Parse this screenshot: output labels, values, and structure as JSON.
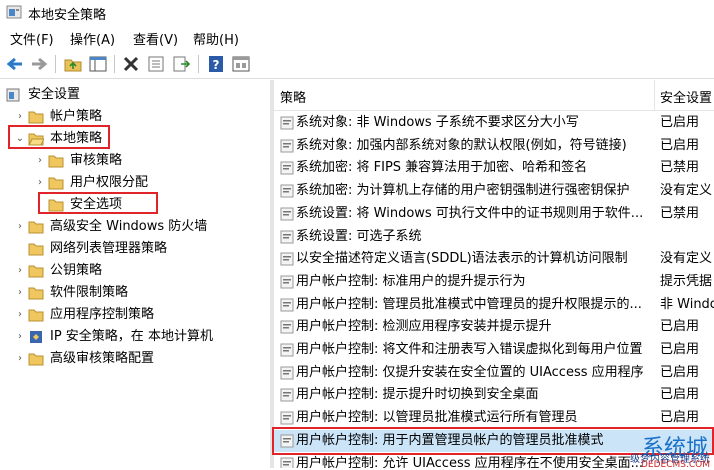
{
  "window": {
    "title": "本地安全策略"
  },
  "menu": [
    "文件(F)",
    "操作(A)",
    "查看(V)",
    "帮助(H)"
  ],
  "toolbar": [
    {
      "icon": "back-arrow-icon"
    },
    {
      "icon": "forward-arrow-icon"
    },
    {
      "icon": "up-folder-icon"
    },
    {
      "icon": "show-hide-tree-icon"
    },
    {
      "icon": "delete-icon"
    },
    {
      "icon": "properties-icon"
    },
    {
      "icon": "export-list-icon"
    },
    {
      "icon": "help-icon"
    },
    {
      "icon": "view-icon"
    }
  ],
  "tree": [
    {
      "label": "安全设置",
      "level": 0,
      "expander": "",
      "icon": "security-settings-icon"
    },
    {
      "label": "帐户策略",
      "level": 1,
      "expander": "›",
      "icon": "folder-icon"
    },
    {
      "label": "本地策略",
      "level": 1,
      "expander": "⌄",
      "icon": "folder-open-icon"
    },
    {
      "label": "审核策略",
      "level": 2,
      "expander": "›",
      "icon": "folder-icon"
    },
    {
      "label": "用户权限分配",
      "level": 2,
      "expander": "›",
      "icon": "folder-icon"
    },
    {
      "label": "安全选项",
      "level": 2,
      "expander": "",
      "icon": "folder-icon"
    },
    {
      "label": "高级安全 Windows 防火墙",
      "level": 1,
      "expander": "›",
      "icon": "folder-icon"
    },
    {
      "label": "网络列表管理器策略",
      "level": 1,
      "expander": "",
      "icon": "folder-icon"
    },
    {
      "label": "公钥策略",
      "level": 1,
      "expander": "›",
      "icon": "folder-icon"
    },
    {
      "label": "软件限制策略",
      "level": 1,
      "expander": "›",
      "icon": "folder-icon"
    },
    {
      "label": "应用程序控制策略",
      "level": 1,
      "expander": "›",
      "icon": "folder-icon"
    },
    {
      "label": "IP 安全策略，在 本地计算机",
      "level": 1,
      "expander": "›",
      "icon": "ip-security-icon"
    },
    {
      "label": "高级审核策略配置",
      "level": 1,
      "expander": "›",
      "icon": "folder-icon"
    }
  ],
  "list": {
    "columns": [
      "策略",
      "安全设置"
    ],
    "rows": [
      {
        "policy": "系统对象: 非 Windows 子系统不要求区分大小写",
        "setting": "已启用"
      },
      {
        "policy": "系统对象: 加强内部系统对象的默认权限(例如，符号链接)",
        "setting": "已启用"
      },
      {
        "policy": "系统加密: 将 FIPS 兼容算法用于加密、哈希和签名",
        "setting": "已禁用"
      },
      {
        "policy": "系统加密: 为计算机上存储的用户密钥强制进行强密钥保护",
        "setting": "没有定义"
      },
      {
        "policy": "系统设置: 将 Windows 可执行文件中的证书规则用于软件...",
        "setting": "已禁用"
      },
      {
        "policy": "系统设置: 可选子系统",
        "setting": ""
      },
      {
        "policy": "以安全描述符定义语言(SDDL)语法表示的计算机访问限制",
        "setting": "没有定义"
      },
      {
        "policy": "用户帐户控制: 标准用户的提升提示行为",
        "setting": "提示凭据"
      },
      {
        "policy": "用户帐户控制: 管理员批准模式中管理员的提升权限提示的...",
        "setting": "非 Windo"
      },
      {
        "policy": "用户帐户控制: 检测应用程序安装并提示提升",
        "setting": "已启用"
      },
      {
        "policy": "用户帐户控制: 将文件和注册表写入错误虚拟化到每用户位置",
        "setting": "已启用"
      },
      {
        "policy": "用户帐户控制: 仅提升安装在安全位置的 UIAccess 应用程序",
        "setting": "已启用"
      },
      {
        "policy": "用户帐户控制: 提示提升时切换到安全桌面",
        "setting": "已启用"
      },
      {
        "policy": "用户帐户控制: 以管理员批准模式运行所有管理员",
        "setting": "已启用"
      },
      {
        "policy": "用户帐户控制: 用于内置管理员帐户的管理员批准模式",
        "setting": ""
      },
      {
        "policy": "用户帐户控制: 允许 UIAccess 应用程序在不使用安全桌面...",
        "setting": ""
      }
    ]
  },
  "watermark": {
    "brand": "系统城",
    "line1": "级梦内容管理系统",
    "line2": "DEDECMS.COM"
  }
}
